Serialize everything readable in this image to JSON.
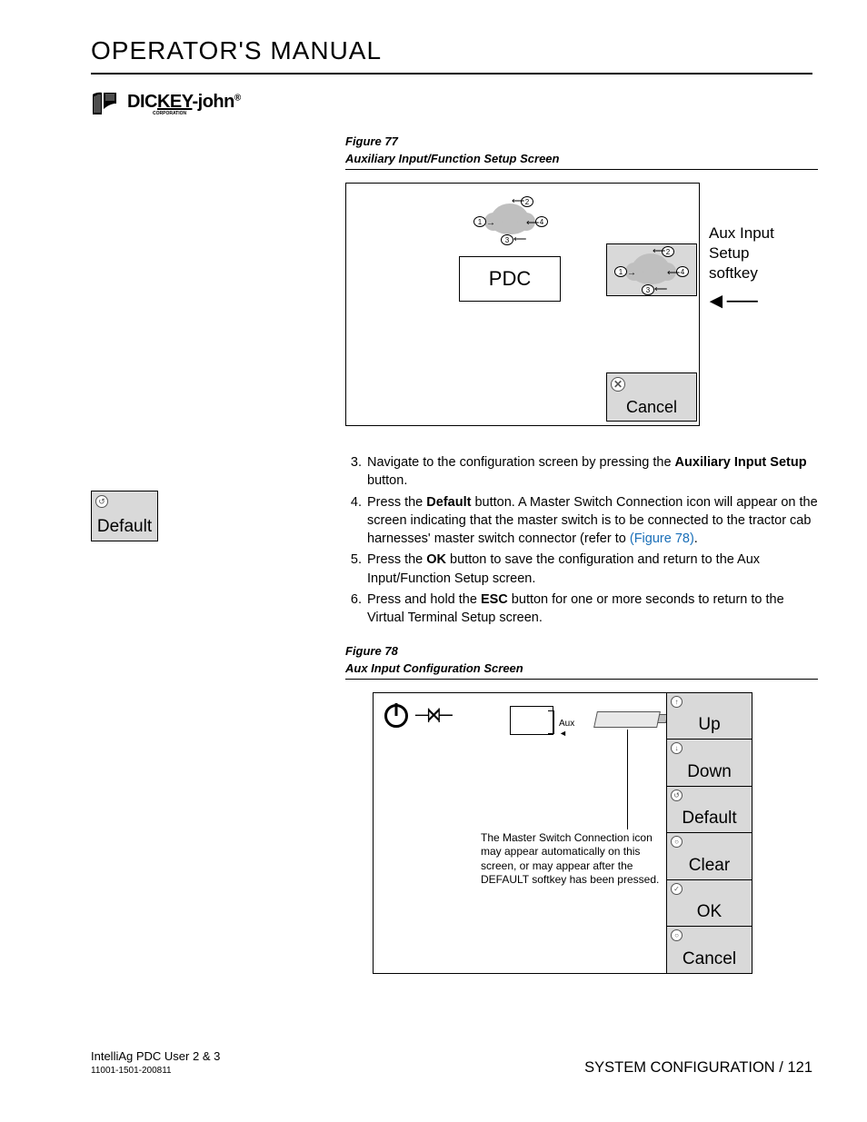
{
  "header": {
    "title": "OPERATOR'S MANUAL",
    "brand_pre": "DIC",
    "brand_key": "KEY",
    "brand_post": "-john",
    "brand_sub": "CORPORATION"
  },
  "fig77": {
    "label": "Figure 77",
    "title": "Auxiliary Input/Function Setup Screen",
    "pdc": "PDC",
    "cancel": "Cancel",
    "side_label_l1": "Aux Input",
    "side_label_l2": "Setup",
    "side_label_l3": "softkey",
    "b1": "1",
    "b2": "2",
    "b3": "3",
    "b4": "4"
  },
  "margin_button": {
    "label": "Default"
  },
  "steps": {
    "s3_a": "Navigate to the configuration screen by pressing the ",
    "s3_b": "Auxiliary Input Setup",
    "s3_c": " button.",
    "s4_a": "Press the ",
    "s4_b": "Default",
    "s4_c": " button. A Master Switch Connection icon will appear on the screen indicating that the master switch is to be connected to the tractor cab harnesses' master switch connector (refer to ",
    "s4_link": "(Figure 78)",
    "s4_d": ".",
    "s5_a": "Press the ",
    "s5_b": "OK",
    "s5_c": " button to save the configuration and return to the Aux Input/Function Setup screen.",
    "s6_a": "Press and hold the ",
    "s6_b": "ESC",
    "s6_c": " button for one or more seconds to return to the Virtual Terminal Setup screen."
  },
  "fig78": {
    "label": "Figure 78",
    "title": "Aux Input Configuration Screen",
    "aux": "Aux",
    "note": "The Master Switch Connection icon may appear automatically on this screen, or may appear after the DEFAULT softkey has been pressed.",
    "softkeys": {
      "up": "Up",
      "down": "Down",
      "default": "Default",
      "clear": "Clear",
      "ok": "OK",
      "cancel": "Cancel"
    }
  },
  "footer": {
    "product": "IntelliAg PDC User 2 & 3",
    "doc_no": "11001-1501-200811",
    "section": "SYSTEM CONFIGURATION / 121"
  }
}
